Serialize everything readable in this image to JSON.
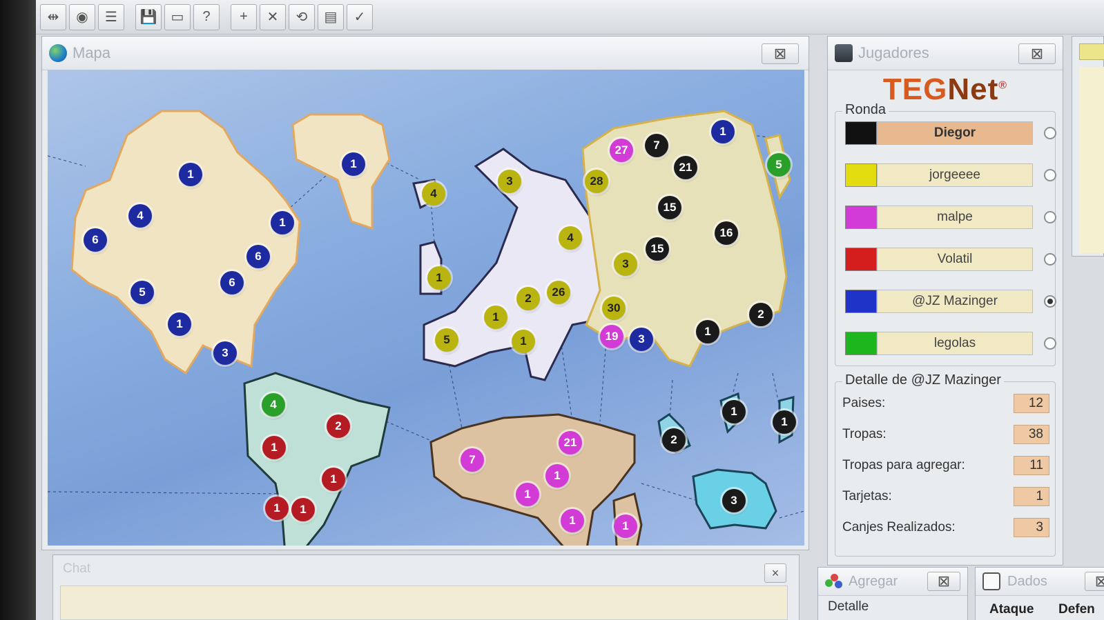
{
  "toolbar": {
    "buttons": [
      {
        "icon": "plug-icon",
        "glyph": "⇹"
      },
      {
        "icon": "connect-icon",
        "glyph": "◉"
      },
      {
        "icon": "list-icon",
        "glyph": "☰"
      },
      {
        "icon": "save-icon",
        "glyph": "💾"
      },
      {
        "icon": "card-icon",
        "glyph": "▭"
      },
      {
        "icon": "help-icon",
        "glyph": "?"
      },
      {
        "icon": "add-icon",
        "glyph": "+"
      },
      {
        "icon": "attack-icon",
        "glyph": "✕"
      },
      {
        "icon": "regroup-icon",
        "glyph": "⟲"
      },
      {
        "icon": "cards-icon",
        "glyph": "▤"
      },
      {
        "icon": "end-turn-icon",
        "glyph": "✓"
      }
    ]
  },
  "map_window": {
    "title": "Mapa",
    "close": "⊠"
  },
  "chat_window": {
    "title": "Chat",
    "close": "×"
  },
  "players_window": {
    "title": "Jugadores",
    "close": "⊠",
    "logo_a": "TEG",
    "logo_b": "Net",
    "logo_mark": "®",
    "round_label": "Ronda",
    "players": [
      {
        "name": "Diegor",
        "color": "#111111",
        "active": true,
        "selected": false
      },
      {
        "name": "jorgeeee",
        "color": "#e3dc10",
        "active": false,
        "selected": false
      },
      {
        "name": "malpe",
        "color": "#d23bd6",
        "active": false,
        "selected": false
      },
      {
        "name": "Volatil",
        "color": "#d41e1e",
        "active": false,
        "selected": false
      },
      {
        "name": "@JZ Mazinger",
        "color": "#1f33c9",
        "active": false,
        "selected": true
      },
      {
        "name": "legolas",
        "color": "#1db61d",
        "active": false,
        "selected": false
      }
    ],
    "detail_label": "Detalle de @JZ Mazinger",
    "details": [
      {
        "label": "Paises:",
        "value": "12"
      },
      {
        "label": "Tropas:",
        "value": "38"
      },
      {
        "label": "Tropas para agregar:",
        "value": "11"
      },
      {
        "label": "Tarjetas:",
        "value": "1"
      },
      {
        "label": "Canjes Realizados:",
        "value": "3"
      }
    ]
  },
  "agregar_window": {
    "title": "Agregar",
    "close": "⊠",
    "detail_label": "Detalle"
  },
  "dados_window": {
    "title": "Dados",
    "close": "⊠",
    "attack_label": "Ataque",
    "defense_label": "Defen"
  },
  "colors": {
    "black": "#1a1a1a",
    "yellow": "#b9b40f",
    "magenta": "#d23bd6",
    "red": "#b51b22",
    "blue": "#1e2aa0",
    "green": "#2aa02a"
  },
  "troops": [
    {
      "value": "1",
      "owner": "blue"
    },
    {
      "value": "1",
      "owner": "blue"
    },
    {
      "value": "4",
      "owner": "blue"
    },
    {
      "value": "1",
      "owner": "blue"
    },
    {
      "value": "6",
      "owner": "blue"
    },
    {
      "value": "6",
      "owner": "blue"
    },
    {
      "value": "6",
      "owner": "blue"
    },
    {
      "value": "5",
      "owner": "blue"
    },
    {
      "value": "1",
      "owner": "blue"
    },
    {
      "value": "3",
      "owner": "blue"
    },
    {
      "value": "4",
      "owner": "yellow"
    },
    {
      "value": "3",
      "owner": "yellow"
    },
    {
      "value": "4",
      "owner": "yellow"
    },
    {
      "value": "1",
      "owner": "yellow"
    },
    {
      "value": "2",
      "owner": "yellow"
    },
    {
      "value": "26",
      "owner": "yellow"
    },
    {
      "value": "1",
      "owner": "yellow"
    },
    {
      "value": "5",
      "owner": "yellow"
    },
    {
      "value": "1",
      "owner": "yellow"
    },
    {
      "value": "27",
      "owner": "magenta"
    },
    {
      "value": "7",
      "owner": "black"
    },
    {
      "value": "28",
      "owner": "yellow"
    },
    {
      "value": "21",
      "owner": "black"
    },
    {
      "value": "1",
      "owner": "blue"
    },
    {
      "value": "5",
      "owner": "green"
    },
    {
      "value": "15",
      "owner": "black"
    },
    {
      "value": "16",
      "owner": "black"
    },
    {
      "value": "15",
      "owner": "black"
    },
    {
      "value": "3",
      "owner": "yellow"
    },
    {
      "value": "30",
      "owner": "yellow"
    },
    {
      "value": "19",
      "owner": "magenta"
    },
    {
      "value": "3",
      "owner": "blue"
    },
    {
      "value": "2",
      "owner": "black"
    },
    {
      "value": "1",
      "owner": "black"
    },
    {
      "value": "4",
      "owner": "green"
    },
    {
      "value": "2",
      "owner": "red"
    },
    {
      "value": "1",
      "owner": "red"
    },
    {
      "value": "1",
      "owner": "red"
    },
    {
      "value": "1",
      "owner": "red"
    },
    {
      "value": "1",
      "owner": "red"
    },
    {
      "value": "7",
      "owner": "magenta"
    },
    {
      "value": "21",
      "owner": "magenta"
    },
    {
      "value": "1",
      "owner": "magenta"
    },
    {
      "value": "1",
      "owner": "magenta"
    },
    {
      "value": "1",
      "owner": "magenta"
    },
    {
      "value": "1",
      "owner": "magenta"
    },
    {
      "value": "2",
      "owner": "black"
    },
    {
      "value": "1",
      "owner": "black"
    },
    {
      "value": "1",
      "owner": "black"
    },
    {
      "value": "3",
      "owner": "black"
    }
  ]
}
